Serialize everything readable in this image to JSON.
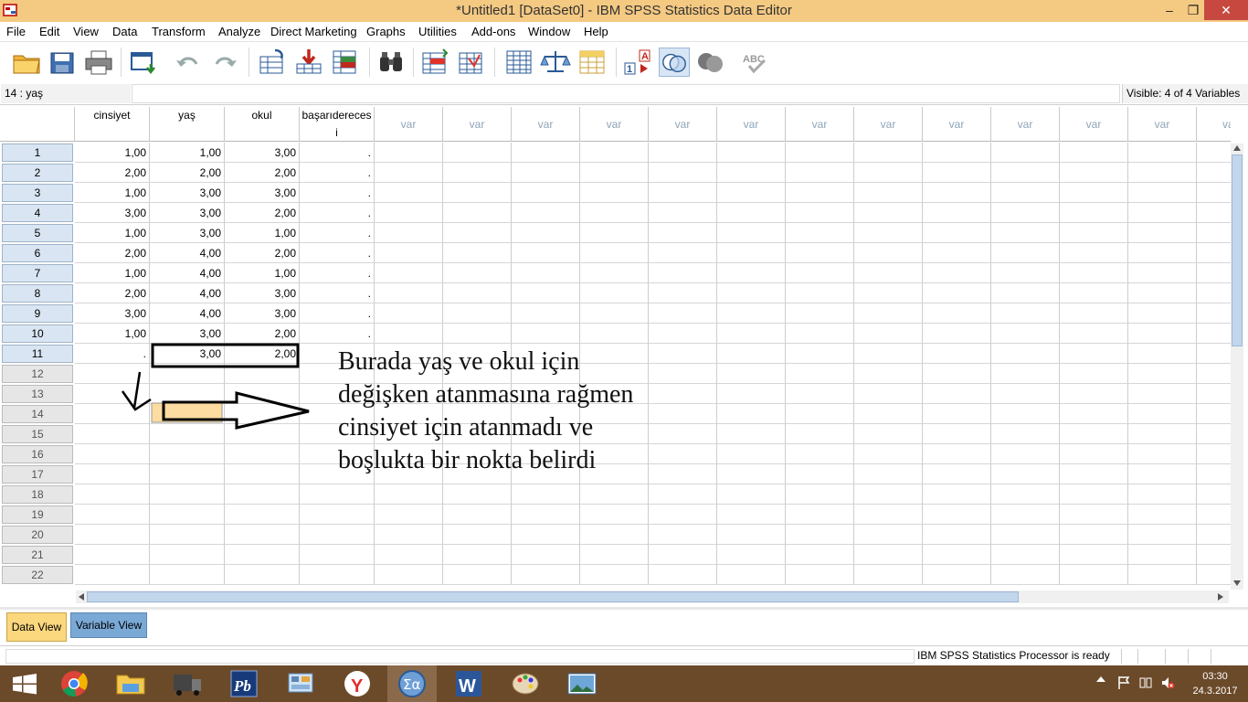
{
  "window": {
    "title": "*Untitled1 [DataSet0] - IBM SPSS Statistics Data Editor",
    "minimize_glyph": "–",
    "maximize_glyph": "❐",
    "close_glyph": "✕"
  },
  "menu": [
    "File",
    "Edit",
    "View",
    "Data",
    "Transform",
    "Analyze",
    "Direct Marketing",
    "Graphs",
    "Utilities",
    "Add-ons",
    "Window",
    "Help"
  ],
  "toolbar_icons": [
    "open-folder-icon",
    "save-icon",
    "print-icon",
    "dialog-recall-icon",
    "undo-icon",
    "redo-icon",
    "goto-case-icon",
    "goto-variable-icon",
    "variables-icon",
    "find-icon",
    "insert-cases-icon",
    "insert-variable-icon",
    "split-file-icon",
    "weight-cases-icon",
    "select-cases-icon",
    "value-labels-icon",
    "use-sets-icon",
    "show-all-variables-icon",
    "spell-check-icon"
  ],
  "cellbar": {
    "ref": "14 : yaş",
    "value": "",
    "visible": "Visible: 4 of 4 Variables"
  },
  "columns": [
    "cinsiyet",
    "yaş",
    "okul",
    "başarıderecesi"
  ],
  "empty_column_label": "var",
  "rows": [
    {
      "n": "1",
      "cinsiyet": "1,00",
      "yas": "1,00",
      "okul": "3,00",
      "basari": "."
    },
    {
      "n": "2",
      "cinsiyet": "2,00",
      "yas": "2,00",
      "okul": "2,00",
      "basari": "."
    },
    {
      "n": "3",
      "cinsiyet": "1,00",
      "yas": "3,00",
      "okul": "3,00",
      "basari": "."
    },
    {
      "n": "4",
      "cinsiyet": "3,00",
      "yas": "3,00",
      "okul": "2,00",
      "basari": "."
    },
    {
      "n": "5",
      "cinsiyet": "1,00",
      "yas": "3,00",
      "okul": "1,00",
      "basari": "."
    },
    {
      "n": "6",
      "cinsiyet": "2,00",
      "yas": "4,00",
      "okul": "2,00",
      "basari": "."
    },
    {
      "n": "7",
      "cinsiyet": "1,00",
      "yas": "4,00",
      "okul": "1,00",
      "basari": "."
    },
    {
      "n": "8",
      "cinsiyet": "2,00",
      "yas": "4,00",
      "okul": "3,00",
      "basari": "."
    },
    {
      "n": "9",
      "cinsiyet": "3,00",
      "yas": "4,00",
      "okul": "3,00",
      "basari": "."
    },
    {
      "n": "10",
      "cinsiyet": "1,00",
      "yas": "3,00",
      "okul": "2,00",
      "basari": "."
    },
    {
      "n": "11",
      "cinsiyet": ".",
      "yas": "3,00",
      "okul": "2,00",
      "basari": ""
    }
  ],
  "empty_rows": [
    "12",
    "13",
    "14",
    "15",
    "16",
    "17",
    "18",
    "19",
    "20",
    "21",
    "22"
  ],
  "annotation": [
    "Burada yaş ve okul için",
    "değişken atanmasına rağmen",
    "cinsiyet için atanmadı ve",
    "boşlukta bir nokta belirdi"
  ],
  "tabs": {
    "data_view": "Data View",
    "variable_view": "Variable View"
  },
  "status": "IBM SPSS Statistics Processor is ready",
  "clock": {
    "time": "03:30",
    "date": "24.3.2017"
  },
  "colors": {
    "titlebar": "#f4c982",
    "taskbar": "#6b4a2a",
    "selected_cell": "#fcdca0",
    "row_header": "#d9e5f2"
  }
}
